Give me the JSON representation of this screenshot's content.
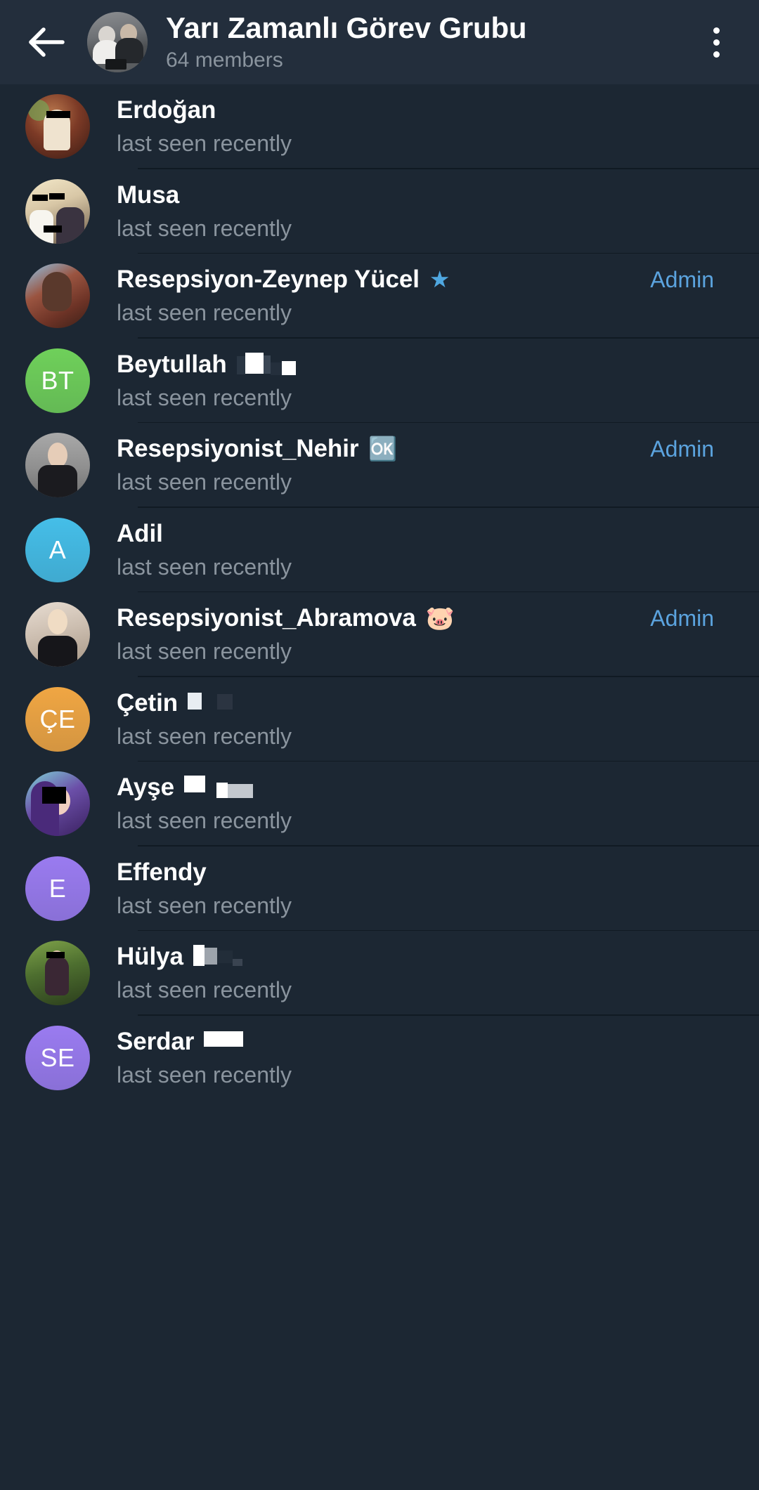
{
  "header": {
    "back_icon": "arrow-left-icon",
    "avatar_alt": "group-photo",
    "title": "Yarı Zamanlı Görev Grubu",
    "subtitle": "64 members",
    "menu_icon": "more-vertical-icon"
  },
  "colors": {
    "header_bg": "#232E3C",
    "list_bg": "#1C2733",
    "divider": "#101A23",
    "name_text": "#FFFFFF",
    "status_text": "#8A949E",
    "admin_text": "#5BA3DE",
    "star_emoji": "#4FA7E0"
  },
  "labels": {
    "admin": "Admin",
    "status_last_seen_recently": "last seen recently"
  },
  "members": [
    {
      "name": "Erdoğan",
      "status": "last seen recently",
      "admin": "",
      "avatar_type": "photo",
      "avatar_class": "ph-erdogan",
      "initials": "",
      "emoji": "",
      "redacted": false
    },
    {
      "name": "Musa",
      "status": "last seen recently",
      "admin": "",
      "avatar_type": "photo",
      "avatar_class": "ph-musa",
      "initials": "",
      "emoji": "",
      "redacted": false
    },
    {
      "name": "Resepsiyon-Zeynep Yücel",
      "status": "last seen recently",
      "admin": "Admin",
      "avatar_type": "photo",
      "avatar_class": "ph-zeynep",
      "initials": "",
      "emoji": "★",
      "emoji_name": "star-emoji",
      "redacted": false
    },
    {
      "name": "Beytullah",
      "status": "last seen recently",
      "admin": "",
      "avatar_type": "initials",
      "avatar_color": "#6FD05A",
      "initials": "BT",
      "emoji": "",
      "redacted": true
    },
    {
      "name": "Resepsiyonist_Nehir",
      "status": "last seen recently",
      "admin": "Admin",
      "avatar_type": "photo",
      "avatar_class": "ph-nehir",
      "initials": "",
      "emoji": "🆗",
      "emoji_name": "blue-badge-emoji",
      "redacted": false
    },
    {
      "name": "Adil",
      "status": "last seen recently",
      "admin": "",
      "avatar_type": "initials",
      "avatar_color": "#45BEE8",
      "initials": "A",
      "emoji": "",
      "redacted": false
    },
    {
      "name": "Resepsiyonist_Abramova",
      "status": "last seen recently",
      "admin": "Admin",
      "avatar_type": "photo",
      "avatar_class": "ph-abramova",
      "initials": "",
      "emoji": "🐷",
      "emoji_name": "pig-face-emoji",
      "redacted": false
    },
    {
      "name": "Çetin",
      "status": "last seen recently",
      "admin": "",
      "avatar_type": "initials",
      "avatar_color": "#F0A643",
      "initials": "ÇE",
      "emoji": "",
      "redacted": true
    },
    {
      "name": "Ayşe",
      "status": "last seen recently",
      "admin": "",
      "avatar_type": "photo",
      "avatar_class": "ph-ayse",
      "initials": "",
      "emoji": "",
      "redacted": true
    },
    {
      "name": "Effendy",
      "status": "last seen recently",
      "admin": "",
      "avatar_type": "initials",
      "avatar_color": "#9A7BF0",
      "initials": "E",
      "emoji": "",
      "redacted": false
    },
    {
      "name": "Hülya",
      "status": "last seen recently",
      "admin": "",
      "avatar_type": "photo",
      "avatar_class": "ph-hulya",
      "initials": "",
      "emoji": "",
      "redacted": true
    },
    {
      "name": "Serdar",
      "status": "last seen recently",
      "admin": "",
      "avatar_type": "initials",
      "avatar_color": "#9A7BF0",
      "initials": "SE",
      "emoji": "",
      "redacted": true
    }
  ]
}
